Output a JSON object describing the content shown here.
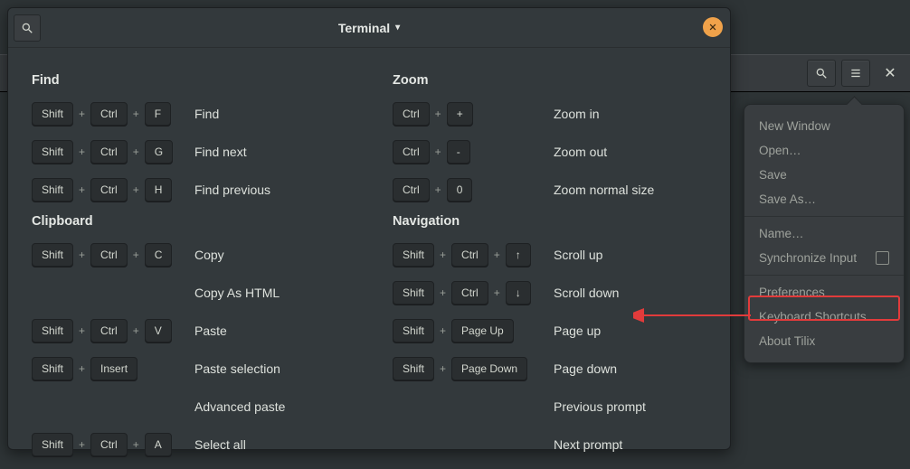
{
  "dialog": {
    "title": "Terminal",
    "sections_left": [
      {
        "title": "Find",
        "items": [
          {
            "keys": [
              "Shift",
              "Ctrl",
              "F"
            ],
            "desc": "Find"
          },
          {
            "keys": [
              "Shift",
              "Ctrl",
              "G"
            ],
            "desc": "Find next"
          },
          {
            "keys": [
              "Shift",
              "Ctrl",
              "H"
            ],
            "desc": "Find previous"
          }
        ]
      },
      {
        "title": "Clipboard",
        "items": [
          {
            "keys": [
              "Shift",
              "Ctrl",
              "C"
            ],
            "desc": "Copy"
          },
          {
            "keys": [],
            "desc": "Copy As HTML"
          },
          {
            "keys": [
              "Shift",
              "Ctrl",
              "V"
            ],
            "desc": "Paste"
          },
          {
            "keys": [
              "Shift",
              "Insert"
            ],
            "desc": "Paste selection"
          },
          {
            "keys": [],
            "desc": "Advanced paste"
          },
          {
            "keys": [
              "Shift",
              "Ctrl",
              "A"
            ],
            "desc": "Select all"
          }
        ]
      }
    ],
    "sections_right": [
      {
        "title": "Zoom",
        "items": [
          {
            "keys": [
              "Ctrl",
              "+"
            ],
            "desc": "Zoom in"
          },
          {
            "keys": [
              "Ctrl",
              "-"
            ],
            "desc": "Zoom out"
          },
          {
            "keys": [
              "Ctrl",
              "0"
            ],
            "desc": "Zoom normal size"
          }
        ]
      },
      {
        "title": "Navigation",
        "items": [
          {
            "keys": [
              "Shift",
              "Ctrl",
              "↑"
            ],
            "desc": "Scroll up"
          },
          {
            "keys": [
              "Shift",
              "Ctrl",
              "↓"
            ],
            "desc": "Scroll down"
          },
          {
            "keys": [
              "Shift",
              "Page Up"
            ],
            "desc": "Page up"
          },
          {
            "keys": [
              "Shift",
              "Page Down"
            ],
            "desc": "Page down"
          },
          {
            "keys": [],
            "desc": "Previous prompt"
          },
          {
            "keys": [],
            "desc": "Next prompt"
          }
        ]
      }
    ]
  },
  "menu": {
    "items": [
      {
        "label": "New Window"
      },
      {
        "label": "Open…"
      },
      {
        "label": "Save"
      },
      {
        "label": "Save As…"
      },
      {
        "sep": true
      },
      {
        "label": "Name…"
      },
      {
        "label": "Synchronize Input",
        "checkbox": true
      },
      {
        "sep": true
      },
      {
        "label": "Preferences"
      },
      {
        "label": "Keyboard Shortcuts",
        "highlighted": true
      },
      {
        "label": "About Tilix"
      }
    ]
  }
}
